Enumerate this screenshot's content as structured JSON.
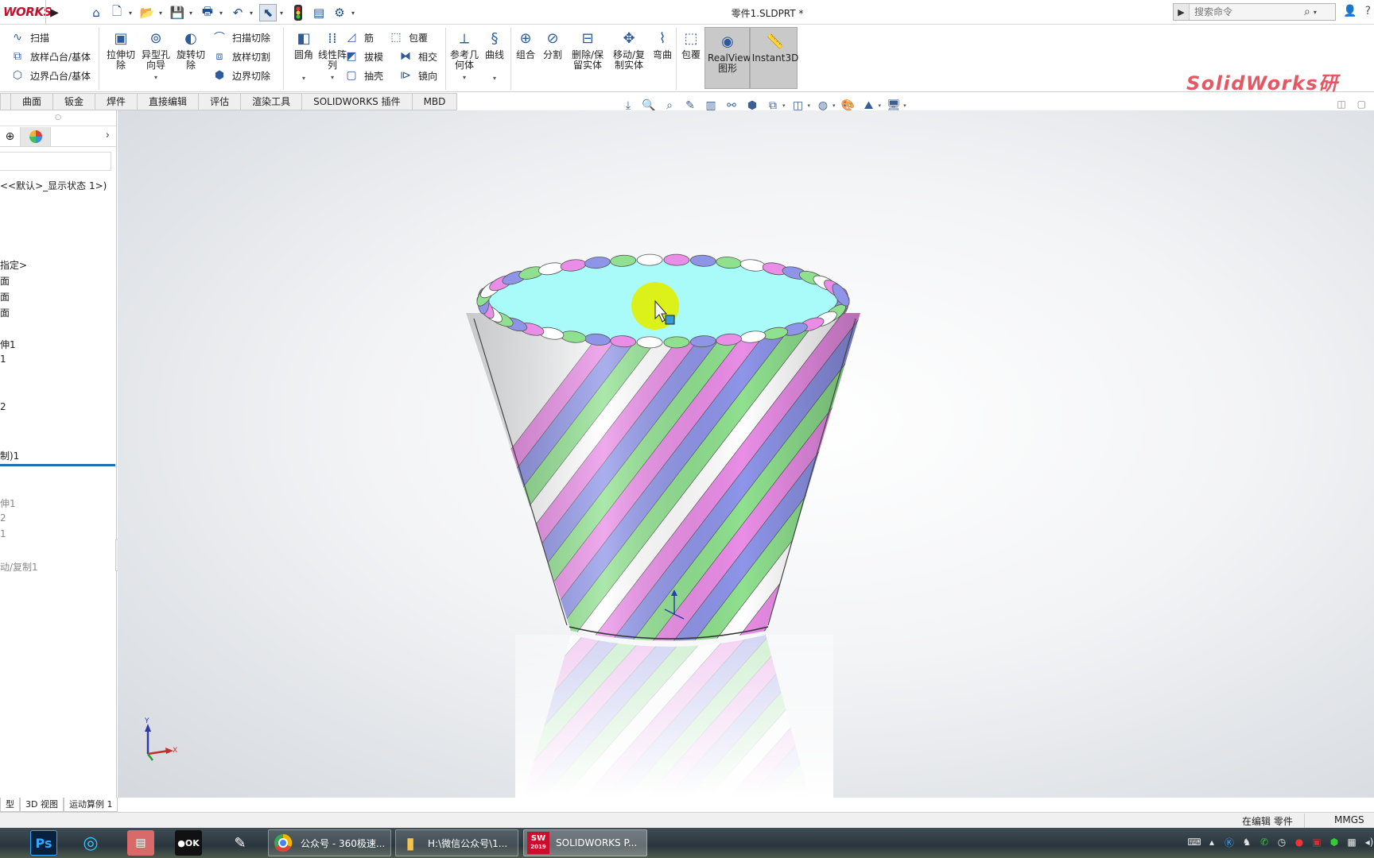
{
  "titlebar": {
    "logo_text": "WORKS",
    "document_title": "零件1.SLDPRT *",
    "search_placeholder": "搜索命令"
  },
  "ribbon": {
    "sweep": "扫描",
    "loft_boss": "放样凸台/基体",
    "boundary_boss": "边界凸台/基体",
    "extrude_cut": "拉伸切除",
    "hole_wizard": "异型孔向导",
    "revolve_cut": "旋转切除",
    "swept_cut": "扫描切除",
    "lofted_cut": "放样切割",
    "boundary_cut": "边界切除",
    "fillet": "圆角",
    "linear_pattern": "线性阵列",
    "rib": "筋",
    "draft": "拔模",
    "shell": "抽壳",
    "wrap": "包覆",
    "intersect": "相交",
    "mirror": "镜向",
    "reference_geometry": "参考几何体",
    "curves": "曲线",
    "combine": "组合",
    "split": "分割",
    "delete_body": "删除/保留实体",
    "move_copy": "移动/复制实体",
    "flex": "弯曲",
    "wrap2": "包覆",
    "realview": "RealView 图形",
    "instant3d": "Instant3D",
    "brand_watermark": "SolidWorks研"
  },
  "tabs": [
    "曲面",
    "钣金",
    "焊件",
    "直接编辑",
    "评估",
    "渲染工具",
    "SOLIDWORKS 插件",
    "MBD"
  ],
  "tree": {
    "display_state": "<<默认>_显示状态 1>)",
    "items": [
      {
        "label": "指定>",
        "grey": false
      },
      {
        "label": "面",
        "grey": false
      },
      {
        "label": "面",
        "grey": false
      },
      {
        "label": "面",
        "grey": false
      },
      {
        "label": "伸1",
        "grey": false
      },
      {
        "label": "1",
        "grey": false
      },
      {
        "label": "2",
        "grey": false
      },
      {
        "label": "制)1",
        "grey": false
      },
      {
        "label": "伸1",
        "grey": true
      },
      {
        "label": "2",
        "grey": true
      },
      {
        "label": "1",
        "grey": true
      },
      {
        "label": "动/复制1",
        "grey": true
      }
    ]
  },
  "bottom_tabs": [
    "型",
    "3D 视图",
    "运动算例 1"
  ],
  "status": {
    "edit_mode": "在编辑 零件",
    "units": "MMGS"
  },
  "taskbar": {
    "tasks": [
      {
        "label": "公众号 - 360极速..."
      },
      {
        "label": "H:\\微信公众号\\1..."
      },
      {
        "label": "SOLIDWORKS P..."
      }
    ],
    "sw_year": "2019"
  },
  "triad": {
    "y": "Y",
    "x": "X"
  },
  "colors": {
    "stripe_pink": "#e98de6",
    "stripe_blue": "#8e94e8",
    "stripe_green": "#8fe08f",
    "top_face": "#a8fbf8",
    "cursor_highlight": "#e0f000",
    "brand": "#e23a4a"
  }
}
